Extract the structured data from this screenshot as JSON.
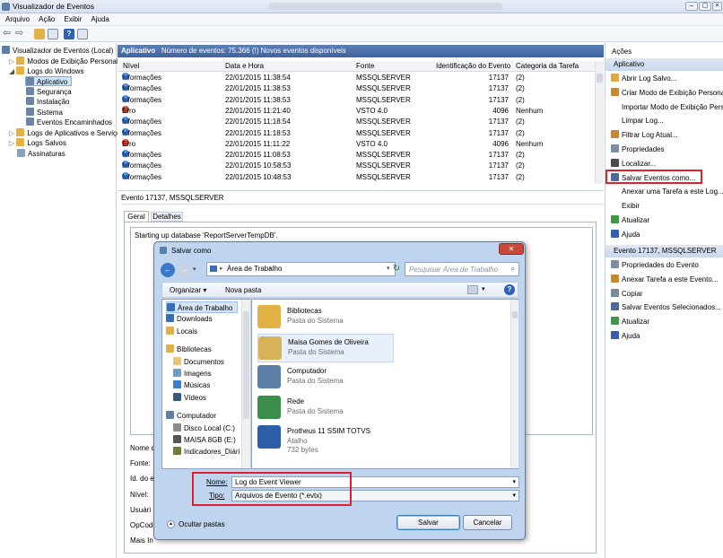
{
  "window": {
    "title": "Visualizador de Eventos"
  },
  "menu": [
    "Arquivo",
    "Ação",
    "Exibir",
    "Ajuda"
  ],
  "tree": [
    {
      "label": "Visualizador de Eventos (Local)",
      "level": 0
    },
    {
      "label": "Modos de Exibição Personali",
      "level": 1
    },
    {
      "label": "Logs do Windows",
      "level": 1
    },
    {
      "label": "Aplicativo",
      "level": 2,
      "selected": true
    },
    {
      "label": "Segurança",
      "level": 2
    },
    {
      "label": "Instalação",
      "level": 2
    },
    {
      "label": "Sistema",
      "level": 2
    },
    {
      "label": "Eventos Encaminhados",
      "level": 2
    },
    {
      "label": "Logs de Aplicativos e Serviço",
      "level": 1
    },
    {
      "label": "Logs Salvos",
      "level": 1
    },
    {
      "label": "Assinaturas",
      "level": 1
    }
  ],
  "log": {
    "name": "Aplicativo",
    "summary": "Número de eventos: 75.366 (!) Novos eventos disponíveis"
  },
  "columns": [
    "Nível",
    "Data e Hora",
    "Fonte",
    "Identificação do Evento",
    "Categoria da Tarefa"
  ],
  "events": [
    {
      "level": "Informações",
      "date": "22/01/2015 11:38:54",
      "source": "MSSQLSERVER",
      "id": "17137",
      "cat": "(2)",
      "type": "info"
    },
    {
      "level": "Informações",
      "date": "22/01/2015 11:38:53",
      "source": "MSSQLSERVER",
      "id": "17137",
      "cat": "(2)",
      "type": "info"
    },
    {
      "level": "Informações",
      "date": "22/01/2015 11:38:53",
      "source": "MSSQLSERVER",
      "id": "17137",
      "cat": "(2)",
      "type": "info"
    },
    {
      "level": "Erro",
      "date": "22/01/2015 11:21:40",
      "source": "VSTO 4.0",
      "id": "4096",
      "cat": "Nenhum",
      "type": "error"
    },
    {
      "level": "Informações",
      "date": "22/01/2015 11:18:54",
      "source": "MSSQLSERVER",
      "id": "17137",
      "cat": "(2)",
      "type": "info"
    },
    {
      "level": "Informações",
      "date": "22/01/2015 11:18:53",
      "source": "MSSQLSERVER",
      "id": "17137",
      "cat": "(2)",
      "type": "info"
    },
    {
      "level": "Erro",
      "date": "22/01/2015 11:11:22",
      "source": "VSTO 4.0",
      "id": "4096",
      "cat": "Nenhum",
      "type": "error"
    },
    {
      "level": "Informações",
      "date": "22/01/2015 11:08:53",
      "source": "MSSQLSERVER",
      "id": "17137",
      "cat": "(2)",
      "type": "info"
    },
    {
      "level": "Informações",
      "date": "22/01/2015 10:58:53",
      "source": "MSSQLSERVER",
      "id": "17137",
      "cat": "(2)",
      "type": "info"
    },
    {
      "level": "Informações",
      "date": "22/01/2015 10:48:53",
      "source": "MSSQLSERVER",
      "id": "17137",
      "cat": "(2)",
      "type": "info"
    }
  ],
  "detail": {
    "title": "Evento 17137, MSSQLSERVER",
    "tabs": [
      "Geral",
      "Detalhes"
    ],
    "text": "Starting up database 'ReportServerTempDB'.",
    "fields": [
      "Nome do",
      "Fonte:",
      "Id. do e",
      "Nível:",
      "Usuári",
      "OpCode",
      "Mais In"
    ]
  },
  "actions": {
    "header": "Ações",
    "section1": "Aplicativo",
    "items1": [
      {
        "label": "Abrir Log Salvo...",
        "icon": "folder-icon",
        "color": "#e1a93a"
      },
      {
        "label": "Criar Modo de Exibição Persona",
        "icon": "filter-icon",
        "color": "#c98a2c"
      },
      {
        "label": "Importar Modo de Exibição Pers",
        "icon": "blank",
        "color": ""
      },
      {
        "label": "Limpar Log...",
        "icon": "blank",
        "color": ""
      },
      {
        "label": "Filtrar Log Atual...",
        "icon": "filter-icon",
        "color": "#c98a2c"
      },
      {
        "label": "Propriedades",
        "icon": "properties-icon",
        "color": "#7c8ea6"
      },
      {
        "label": "Localizar...",
        "icon": "binoculars-icon",
        "color": "#4a4a4a"
      },
      {
        "label": "Salvar Eventos como...",
        "icon": "save-icon",
        "color": "#4a6aa3"
      },
      {
        "label": "Anexar uma Tarefa a este Log...",
        "icon": "blank",
        "color": ""
      },
      {
        "label": "Exibir",
        "icon": "blank",
        "color": ""
      },
      {
        "label": "Atualizar",
        "icon": "refresh-icon",
        "color": "#3b9a3b"
      },
      {
        "label": "Ajuda",
        "icon": "help-icon",
        "color": "#2f5fb7"
      }
    ],
    "section2": "Evento 17137, MSSQLSERVER",
    "items2": [
      {
        "label": "Propriedades do Evento",
        "icon": "properties-icon",
        "color": "#7c8ea6"
      },
      {
        "label": "Anexar Tarefa a este Evento...",
        "icon": "task-icon",
        "color": "#c98a2c"
      },
      {
        "label": "Copiar",
        "icon": "copy-icon",
        "color": "#7a8aa0"
      },
      {
        "label": "Salvar Eventos Selecionados...",
        "icon": "save-icon",
        "color": "#4a6aa3"
      },
      {
        "label": "Atualizar",
        "icon": "refresh-icon",
        "color": "#3b9a3b"
      },
      {
        "label": "Ajuda",
        "icon": "help-icon",
        "color": "#2f5fb7"
      }
    ]
  },
  "dialog": {
    "title": "Salvar como",
    "address": "Área de Trabalho",
    "search_placeholder": "Pesquisar Área de Trabalho",
    "organize": "Organizar ▾",
    "new_folder": "Nova pasta",
    "nav": [
      {
        "label": "Área de Trabalho",
        "indent": 0,
        "selected": true,
        "color": "#3a6fb5"
      },
      {
        "label": "Downloads",
        "indent": 0,
        "color": "#3a6fb5"
      },
      {
        "label": "Locais",
        "indent": 0,
        "color": "#e3b246"
      },
      {
        "label": "Bibliotecas",
        "indent": 0,
        "color": "#e3b246",
        "gap": true
      },
      {
        "label": "Documentos",
        "indent": 1,
        "color": "#e3c77a"
      },
      {
        "label": "Imagens",
        "indent": 1,
        "color": "#6b9fd0"
      },
      {
        "label": "Músicas",
        "indent": 1,
        "color": "#3a7fd0"
      },
      {
        "label": "Vídeos",
        "indent": 1,
        "color": "#3a5a7a"
      },
      {
        "label": "Computador",
        "indent": 0,
        "color": "#5b7fa6",
        "gap": true
      },
      {
        "label": "Disco Local (C:)",
        "indent": 1,
        "color": "#8b8b8b"
      },
      {
        "label": "MAISA 8GB (E:)",
        "indent": 1,
        "color": "#555"
      },
      {
        "label": "Indicadores_Diári",
        "indent": 1,
        "color": "#6a7f3a"
      }
    ],
    "files": [
      {
        "name": "Bibliotecas",
        "sub": "Pasta do Sistema",
        "color": "#e3b246"
      },
      {
        "name": "Maisa Gomes de Oliveira",
        "sub": "Pasta do Sistema",
        "color": "#d9b35a"
      },
      {
        "name": "Computador",
        "sub": "Pasta do Sistema",
        "color": "#5b7fa6"
      },
      {
        "name": "Rede",
        "sub": "Pasta do Sistema",
        "color": "#3b8f4a"
      },
      {
        "name": "Protheus 11 SSIM TOTVS",
        "sub": "Atalho",
        "sub2": "732 bytes",
        "color": "#2d5fa8"
      }
    ],
    "name_label": "Nome:",
    "name_value": "Log do Event Viewer",
    "type_label": "Tipo:",
    "type_value": "Arquivos de Evento (*.evtx)",
    "hide_folders": "Ocultar pastas",
    "save": "Salvar",
    "cancel": "Cancelar"
  }
}
